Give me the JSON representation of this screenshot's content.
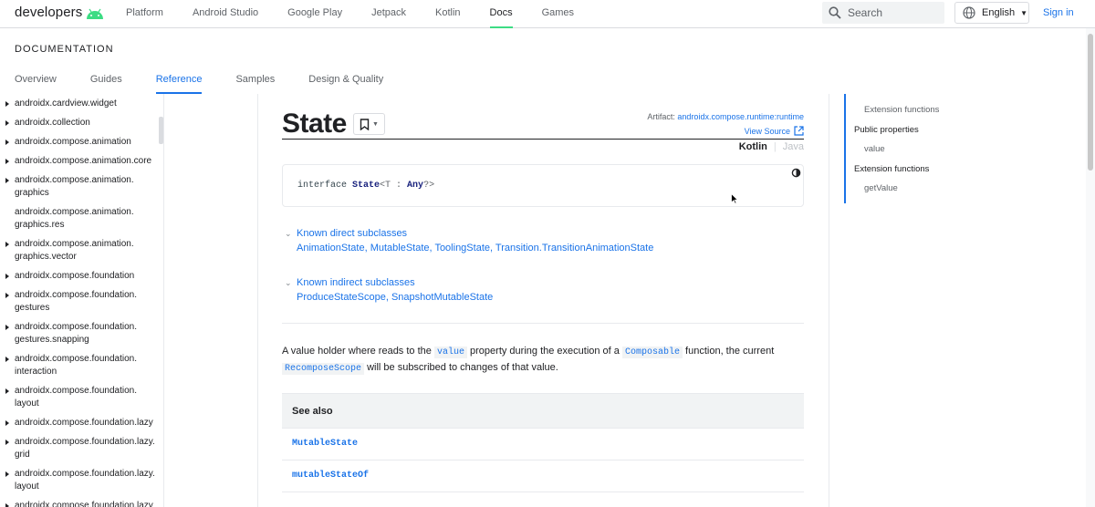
{
  "header": {
    "logo_text": "developers",
    "nav": [
      "Platform",
      "Android Studio",
      "Google Play",
      "Jetpack",
      "Kotlin",
      "Docs",
      "Games"
    ],
    "active_nav": "Docs",
    "search_placeholder": "Search",
    "language": "English",
    "sign_in": "Sign in",
    "accent_color": "#3ddc84",
    "icons": [
      "android-bot-logo",
      "search-icon",
      "globe-icon",
      "caret-down-icon"
    ]
  },
  "doc": {
    "section_title": "DOCUMENTATION",
    "tabs": [
      "Overview",
      "Guides",
      "Reference",
      "Samples",
      "Design & Quality"
    ],
    "active_tab": "Reference"
  },
  "leftnav": {
    "items": [
      "androidx.cardview.widget",
      "androidx.collection",
      "androidx.compose.animation",
      "androidx.compose.animation.core",
      "androidx.compose.animation.\ngraphics",
      "androidx.compose.animation.\ngraphics.res",
      "androidx.compose.animation.\ngraphics.vector",
      "androidx.compose.foundation",
      "androidx.compose.foundation.\ngestures",
      "androidx.compose.foundation.\ngestures.snapping",
      "androidx.compose.foundation.\ninteraction",
      "androidx.compose.foundation.\nlayout",
      "androidx.compose.foundation.lazy",
      "androidx.compose.foundation.lazy.\ngrid",
      "androidx.compose.foundation.lazy.\nlayout",
      "androidx.compose.foundation.lazy"
    ],
    "no_arrow_index": 5
  },
  "main": {
    "title": "State",
    "artifact_label": "Artifact: ",
    "artifact_link": "androidx.compose.runtime:runtime",
    "view_source": "View Source",
    "lang_kotlin": "Kotlin",
    "lang_sep": "|",
    "lang_java": "Java",
    "code": {
      "kw": "interface ",
      "name": "State",
      "generic_open": "<T : ",
      "type": "Any",
      "generic_close": "?>"
    },
    "known_direct_label": "Known direct subclasses",
    "known_direct_list": "AnimationState, MutableState, ToolingState, Transition.TransitionAnimationState",
    "known_indirect_label": "Known indirect subclasses",
    "known_indirect_list": "ProduceStateScope, SnapshotMutableState",
    "desc_1": "A value holder where reads to the ",
    "desc_code_1": "value",
    "desc_2": " property during the execution of a ",
    "desc_code_2": "Composable",
    "desc_3": " function, the current ",
    "desc_code_3": "RecomposeScope",
    "desc_4": " will be subscribed to changes of that value.",
    "see_also_label": "See also",
    "see_also": [
      "MutableState",
      "mutableStateOf"
    ]
  },
  "toc": {
    "items": [
      {
        "label": "Extension functions",
        "level": 2
      },
      {
        "label": "Public properties",
        "level": 1
      },
      {
        "label": "value",
        "level": 2
      },
      {
        "label": "Extension functions",
        "level": 1
      },
      {
        "label": "getValue",
        "level": 2
      }
    ]
  }
}
